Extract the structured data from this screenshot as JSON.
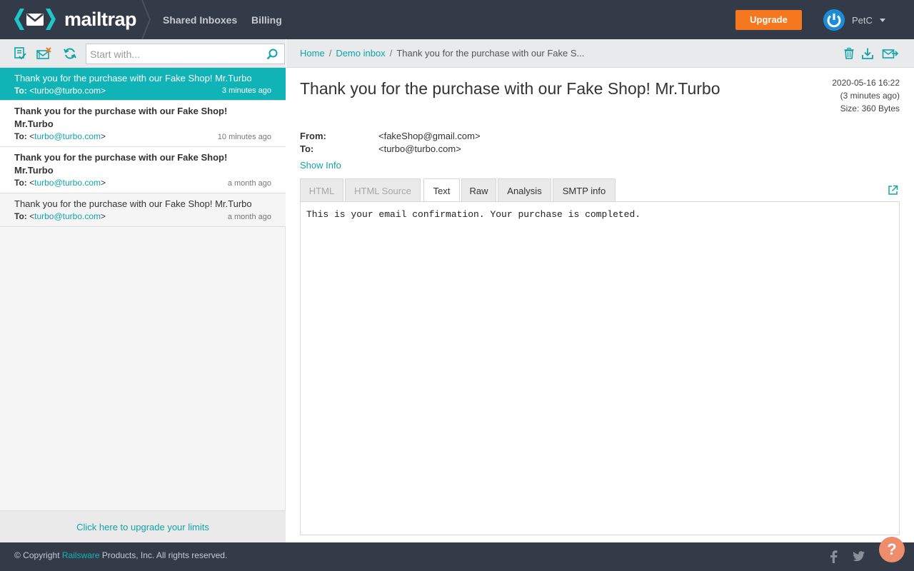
{
  "app": {
    "logo_text": "mailtrap",
    "nav": [
      "Shared Inboxes",
      "Billing"
    ],
    "upgrade_label": "Upgrade",
    "user_name": "PetC"
  },
  "left": {
    "search_placeholder": "Start with...",
    "messages": [
      {
        "subject": "Thank you for the purchase with our Fake Shop! Mr.Turbo",
        "to_label": "To:",
        "to_pre": "<",
        "to_addr": "turbo@turbo.com",
        "to_post": ">",
        "time": "3 minutes ago",
        "selected": true
      },
      {
        "subject": "Thank you for the purchase with our Fake Shop! Mr.Turbo",
        "to_label": "To:",
        "to_pre": "<",
        "to_addr": "turbo@turbo.com",
        "to_post": ">",
        "time": "10 minutes ago"
      },
      {
        "subject": "Thank you for the purchase with our Fake Shop! Mr.Turbo",
        "to_label": "To:",
        "to_pre": "<",
        "to_addr": "turbo@turbo.com",
        "to_post": ">",
        "time": "a month ago"
      },
      {
        "subject": "Thank you for the purchase with our Fake Shop! Mr.Turbo",
        "to_label": "To:",
        "to_pre": "<",
        "to_addr": "turbo@turbo.com",
        "to_post": ">",
        "time": "a month ago"
      }
    ],
    "upgrade_limits": "Click here to upgrade your limits"
  },
  "breadcrumb": {
    "home": "Home",
    "inbox": "Demo inbox",
    "current": "Thank you for the purchase with our Fake S..."
  },
  "message": {
    "subject": "Thank you for the purchase with our Fake Shop! Mr.Turbo",
    "date": "2020-05-16 16:22",
    "ago": "(3 minutes ago)",
    "size": "Size: 360 Bytes",
    "from_label": "From:",
    "from": "<fakeShop@gmail.com>",
    "to_label": "To:",
    "to": "<turbo@turbo.com>",
    "show_info": "Show Info",
    "tabs": [
      "HTML",
      "HTML Source",
      "Text",
      "Raw",
      "Analysis",
      "SMTP info"
    ],
    "active_tab": "Text",
    "body": "This is your email confirmation. Your purchase is completed."
  },
  "footer": {
    "copyright_pre": "© Copyright ",
    "company": "Railsware",
    "copyright_post": " Products, Inc. All rights reserved.",
    "help": "?"
  },
  "colors": {
    "topbar": "#333b48",
    "accent": "#10b4b6",
    "upgrade": "#f5781e",
    "link": "#10a4a8"
  }
}
